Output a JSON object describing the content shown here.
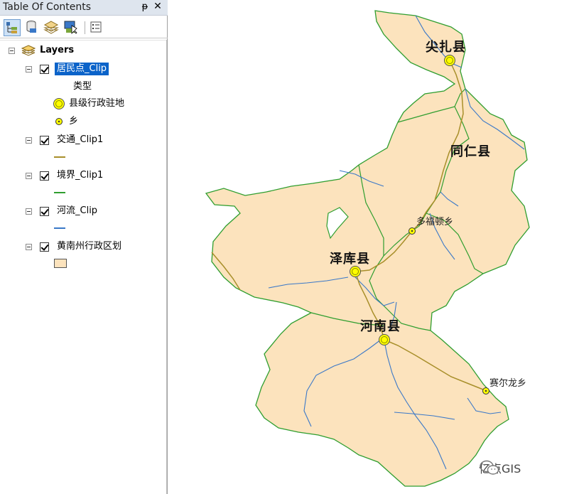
{
  "toc": {
    "title": "Table Of Contents",
    "pin_glyph": "ᵽ",
    "close_glyph": "✕",
    "toolbar": [
      {
        "name": "list-by-drawing-order",
        "icon": "drawing-order-icon",
        "active": true
      },
      {
        "name": "list-by-source",
        "icon": "database-icon",
        "active": false
      },
      {
        "name": "list-by-visibility",
        "icon": "layers-visibility-icon",
        "active": false
      },
      {
        "name": "list-by-selection",
        "icon": "selection-icon",
        "active": false
      },
      {
        "name": "options",
        "icon": "options-icon",
        "active": false
      }
    ],
    "root_label": "Layers",
    "layers": [
      {
        "label": "居民点_Clip",
        "selected": true,
        "legend_heading": "类型",
        "legend": [
          {
            "symbol": "county-seat-symbol",
            "label": "县级行政驻地"
          },
          {
            "symbol": "township-symbol",
            "label": "乡"
          }
        ]
      },
      {
        "label": "交通_Clip1",
        "symbol_color": "#a88f2a"
      },
      {
        "label": "境界_Clip1",
        "symbol_color": "#2f9e2f"
      },
      {
        "label": "河流_Clip",
        "symbol_color": "#3a78c8"
      },
      {
        "label": "黄南州行政区划",
        "symbol_color": "#fce3bd"
      }
    ]
  },
  "map": {
    "fill_color": "#fce3bd",
    "boundary_color": "#2f9e2f",
    "river_color": "#3a78c8",
    "road_color": "#a88f2a",
    "counties": [
      {
        "name": "尖扎县"
      },
      {
        "name": "同仁县"
      },
      {
        "name": "泽库县"
      },
      {
        "name": "河南县"
      }
    ],
    "towns": [
      {
        "name": "多福顿乡"
      },
      {
        "name": "赛尔龙乡"
      }
    ],
    "watermark": "亿点GIS"
  }
}
